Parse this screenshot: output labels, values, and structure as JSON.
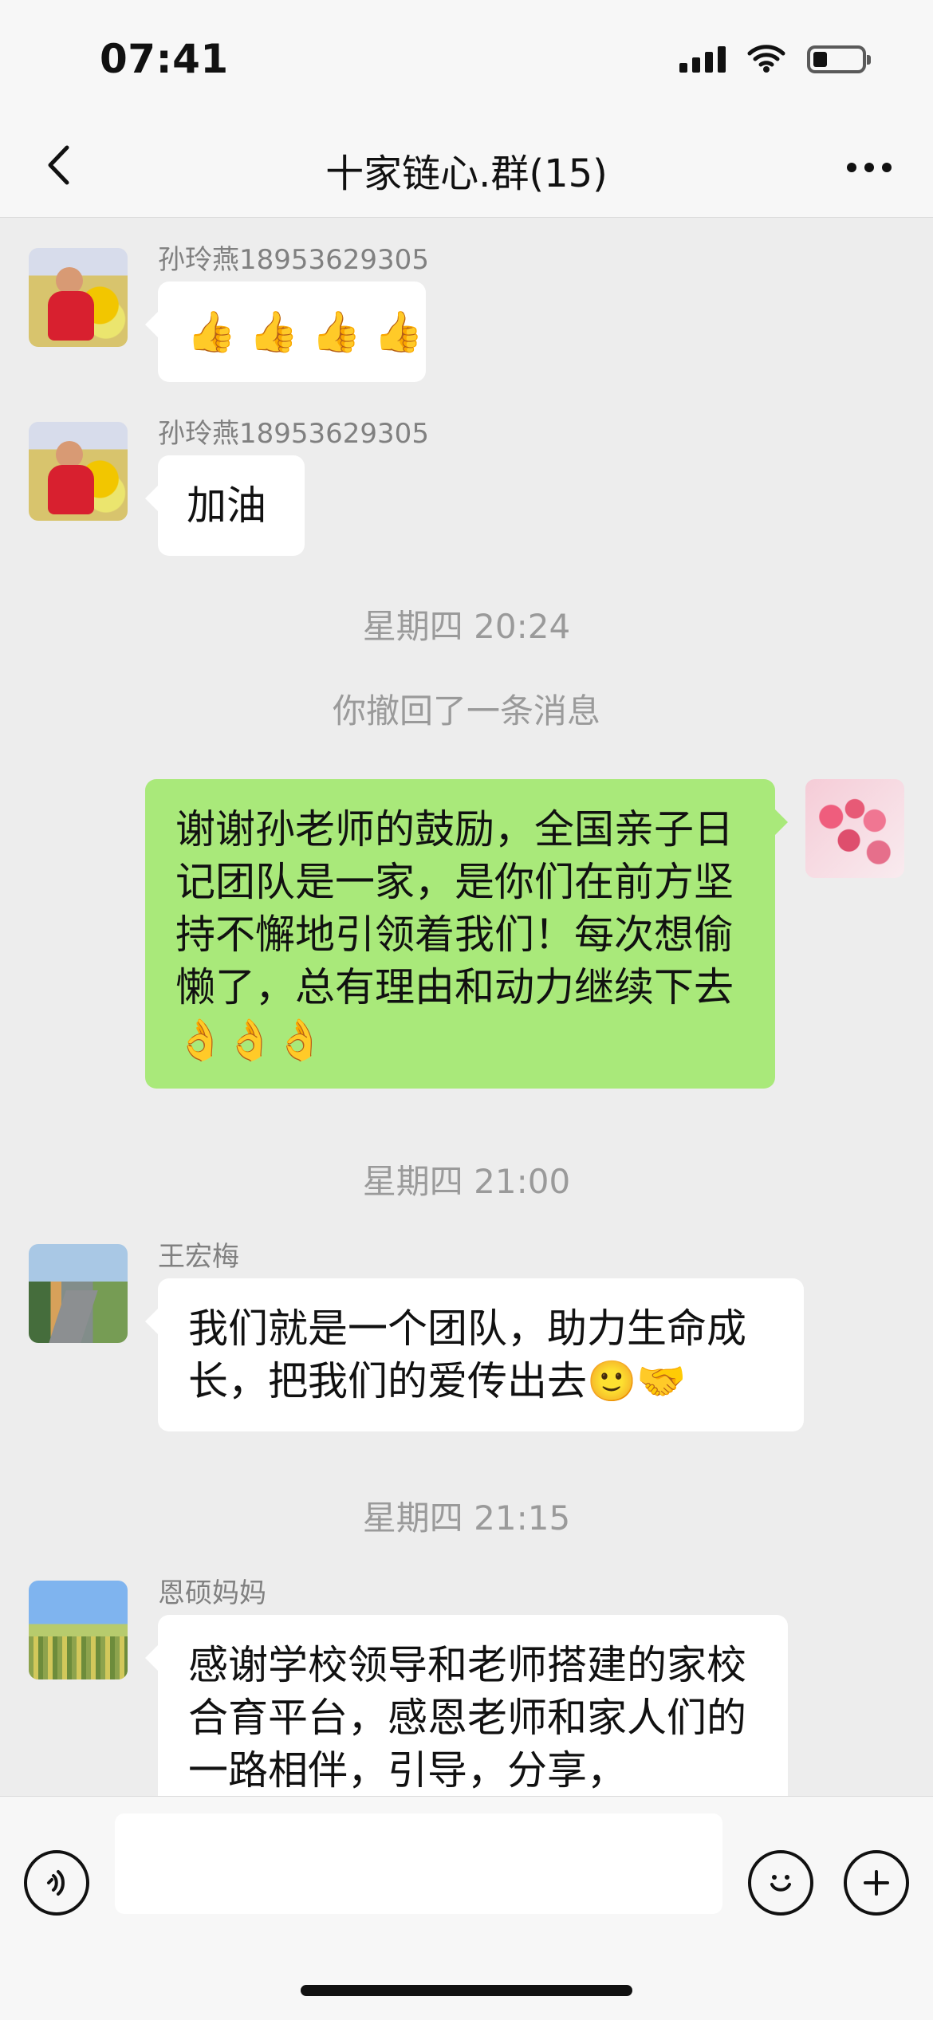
{
  "status_bar": {
    "time": "07:41"
  },
  "header": {
    "title": "十家链心.群(15)"
  },
  "messages": [
    {
      "name": "孙玲燕18953629305",
      "emoji": [
        "👍",
        "👍",
        "👍",
        "👍"
      ]
    },
    {
      "name": "孙玲燕18953629305",
      "text": "加油"
    },
    {
      "time": "星期四 20:24"
    },
    {
      "recall": "你撤回了一条消息"
    },
    {
      "text": "谢谢孙老师的鼓励，全国亲子日记团队是一家，是你们在前方坚持不懈地引领着我们！每次想偷懒了，总有理由和动力继续下去👌👌👌"
    },
    {
      "time": "星期四 21:00"
    },
    {
      "name": "王宏梅",
      "text": "我们就是一个团队，助力生命成长，把我们的爱传出去🙂🤝"
    },
    {
      "time": "星期四 21:15"
    },
    {
      "name": "恩硕妈妈",
      "text": "感谢学校领导和老师搭建的家校合育平台，感恩老师和家人们的一路相伴，引导，分享，"
    }
  ],
  "composer": {
    "placeholder": ""
  },
  "icons": {
    "back": "chevron-left-icon",
    "more": "more-icon",
    "voice": "voice-icon",
    "emoji": "emoji-icon",
    "plus": "plus-icon"
  }
}
